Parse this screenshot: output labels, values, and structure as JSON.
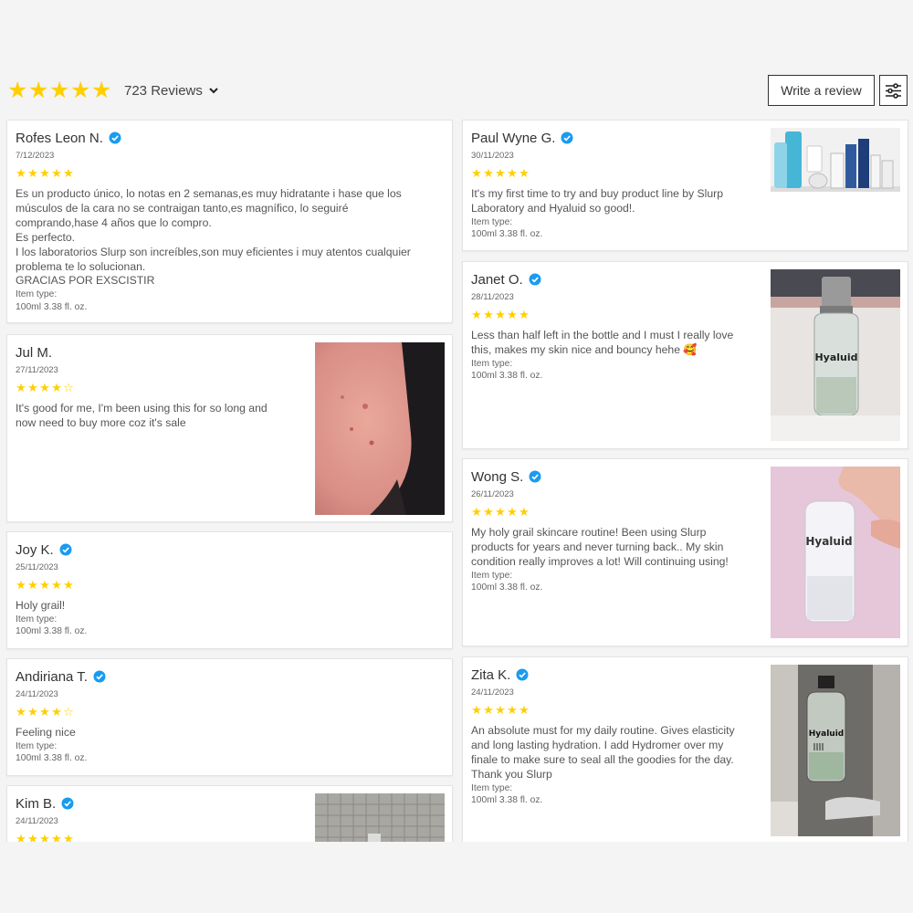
{
  "summary": {
    "stars": [
      "★",
      "★",
      "★",
      "★",
      "★"
    ],
    "review_count": "723 Reviews"
  },
  "actions": {
    "write_review": "Write a review"
  },
  "colors": {
    "star": "#ffcf00",
    "verified": "#1a9bf0",
    "card_bg": "#ffffff",
    "page_bg": "#f4f4f4"
  },
  "reviews": [
    {
      "name": "Rofes Leon N.",
      "date": "7/12/2023",
      "stars": [
        "★",
        "★",
        "★",
        "★",
        "★"
      ],
      "text": "Es un producto único, lo notas en 2 semanas,es muy hidratante i hase que los\nmúsculos de la cara no se contraigan tanto,es magnífico, lo seguiré\ncomprando,hase 4 años que lo compro.\nEs perfecto.\nI los laboratorios Slurp son increíbles,son muy eficientes i muy atentos cualquier\nproblema te lo solucionan.\nGRACIAS POR EXSCISTIR",
      "item_label": "Item type:",
      "item_value": "100ml 3.38 fl. oz."
    },
    {
      "name": "Jul M.",
      "date": "27/11/2023",
      "stars": [
        "★",
        "★",
        "★",
        "★",
        "☆"
      ],
      "text": "It's good for me, I'm been using this for so long and\nnow need to buy more coz it's sale",
      "photo": "skin-closeup-photo"
    },
    {
      "name": "Joy K.",
      "date": "25/11/2023",
      "stars": [
        "★",
        "★",
        "★",
        "★",
        "★"
      ],
      "text": "Holy grail!",
      "item_label": "Item type:",
      "item_value": "100ml 3.38 fl. oz."
    },
    {
      "name": "Andiriana T.",
      "date": "24/11/2023",
      "stars": [
        "★",
        "★",
        "★",
        "★",
        "☆"
      ],
      "text": "Feeling nice",
      "item_label": "Item type:",
      "item_value": "100ml 3.38 fl. oz."
    },
    {
      "name": "Kim B.",
      "date": "24/11/2023",
      "stars": [
        "★",
        "★",
        "★",
        "★",
        "★"
      ],
      "photo": "product-on-tile-photo"
    },
    {
      "name": "Paul Wyne G.",
      "date": "30/11/2023",
      "stars": [
        "★",
        "★",
        "★",
        "★",
        "★"
      ],
      "text": "It's my first time to try and buy product line by Slurp\nLaboratory and Hyaluid so good!.",
      "item_label": "Item type:",
      "item_value": "100ml 3.38 fl. oz.",
      "photo": "product-lineup-photo"
    },
    {
      "name": "Janet O.",
      "date": "28/11/2023",
      "stars": [
        "★",
        "★",
        "★",
        "★",
        "★"
      ],
      "text": "Less than half left in the bottle and I must I really love\nthis, makes my skin nice and bouncy hehe 🥰",
      "item_label": "Item type:",
      "item_value": "100ml 3.38 fl. oz.",
      "photo": "hyaluid-bottle-photo",
      "photo_text": "Hyaluid"
    },
    {
      "name": "Wong S.",
      "date": "26/11/2023",
      "stars": [
        "★",
        "★",
        "★",
        "★",
        "★"
      ],
      "text": "My holy grail skincare routine! Been using Slurp\nproducts for years and never turning back.. My skin\ncondition really improves a lot! Will continuing using!",
      "item_label": "Item type:",
      "item_value": "100ml 3.38 fl. oz.",
      "photo": "hand-holding-bottle-photo",
      "photo_text": "Hyaluid"
    },
    {
      "name": "Zita K.",
      "date": "24/11/2023",
      "stars": [
        "★",
        "★",
        "★",
        "★",
        "★"
      ],
      "text": "An absolute must for my daily routine. Gives elasticity\nand long lasting hydration. I add Hydromer over my\nfinale to make sure to seal all the goodies for the day.\nThank you Slurp",
      "item_label": "Item type:",
      "item_value": "100ml 3.38 fl. oz.",
      "photo": "bottle-by-faucet-photo",
      "photo_text": "Hyaluid"
    }
  ]
}
